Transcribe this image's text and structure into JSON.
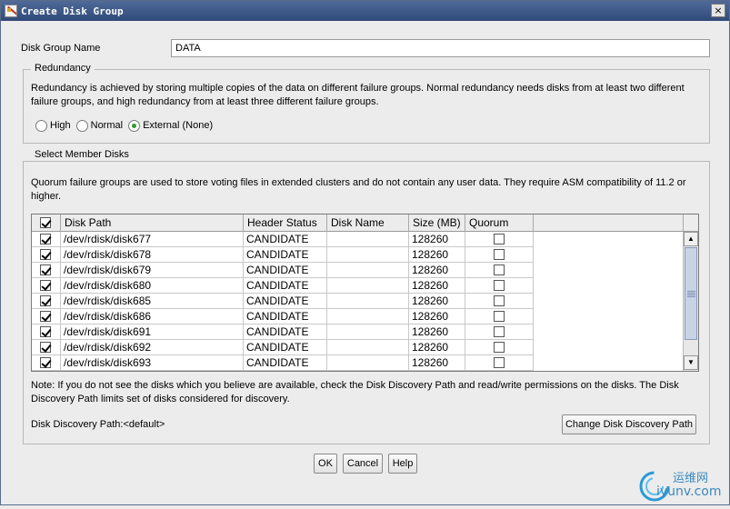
{
  "window": {
    "title": "Create Disk Group",
    "close_glyph": "×"
  },
  "disk_group_name": {
    "label": "Disk Group Name",
    "value": "DATA"
  },
  "redundancy": {
    "legend": "Redundancy",
    "description_line1": "Redundancy is achieved by storing multiple copies of the data on different failure groups. Normal redundancy needs disks from at least two different",
    "description_line2": "failure groups, and high redundancy from at least three different failure groups.",
    "options": [
      {
        "label": "High",
        "selected": false
      },
      {
        "label": "Normal",
        "selected": false
      },
      {
        "label": "External (None)",
        "selected": true
      }
    ]
  },
  "member_disks": {
    "legend": "Select Member Disks",
    "description_line1": "Quorum failure groups are used to store voting files in extended clusters and do not contain any user data. They require ASM compatibility of 11.2 or",
    "description_line2": "higher.",
    "table": {
      "columns": [
        "Disk Path",
        "Header Status",
        "Disk Name",
        "Size (MB)",
        "Quorum"
      ],
      "rows": [
        {
          "selected": true,
          "path": "/dev/rdisk/disk677",
          "status": "CANDIDATE",
          "name": "",
          "size": "128260",
          "quorum": false
        },
        {
          "selected": true,
          "path": "/dev/rdisk/disk678",
          "status": "CANDIDATE",
          "name": "",
          "size": "128260",
          "quorum": false
        },
        {
          "selected": true,
          "path": "/dev/rdisk/disk679",
          "status": "CANDIDATE",
          "name": "",
          "size": "128260",
          "quorum": false
        },
        {
          "selected": true,
          "path": "/dev/rdisk/disk680",
          "status": "CANDIDATE",
          "name": "",
          "size": "128260",
          "quorum": false
        },
        {
          "selected": true,
          "path": "/dev/rdisk/disk685",
          "status": "CANDIDATE",
          "name": "",
          "size": "128260",
          "quorum": false
        },
        {
          "selected": true,
          "path": "/dev/rdisk/disk686",
          "status": "CANDIDATE",
          "name": "",
          "size": "128260",
          "quorum": false
        },
        {
          "selected": true,
          "path": "/dev/rdisk/disk691",
          "status": "CANDIDATE",
          "name": "",
          "size": "128260",
          "quorum": false
        },
        {
          "selected": true,
          "path": "/dev/rdisk/disk692",
          "status": "CANDIDATE",
          "name": "",
          "size": "128260",
          "quorum": false
        },
        {
          "selected": true,
          "path": "/dev/rdisk/disk693",
          "status": "CANDIDATE",
          "name": "",
          "size": "128260",
          "quorum": false
        }
      ]
    },
    "note_line1": "Note: If you do not see the disks which you believe are available, check the Disk Discovery Path and read/write permissions on the disks. The Disk",
    "note_line2": "Discovery Path limits set of disks considered for discovery.",
    "discovery_path": "Disk Discovery Path:<default>",
    "change_path_button": "Change Disk Discovery Path"
  },
  "buttons": {
    "ok": "OK",
    "cancel": "Cancel",
    "help": "Help"
  },
  "watermark": {
    "cn": "运维网",
    "url": "iyunv.com"
  },
  "colors": {
    "title_bar": "#3a5584",
    "radio_selected": "#2f9a2f",
    "scroll_thumb": "#c8d4e6"
  }
}
